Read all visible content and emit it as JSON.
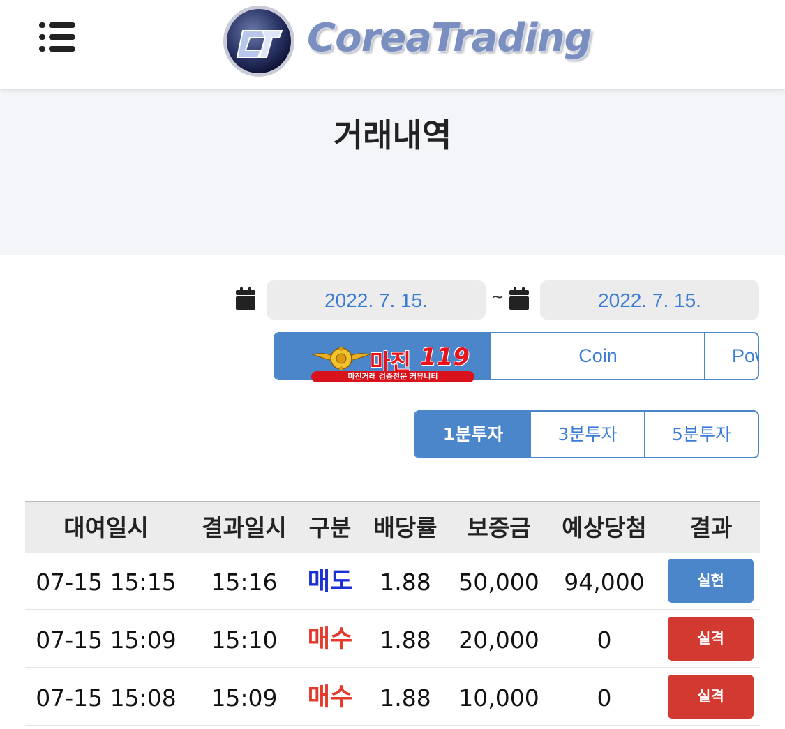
{
  "header": {
    "logo_text": "CoreaTrading",
    "logo_mark_text": "CT"
  },
  "page_title": "거래내역",
  "date_range": {
    "start": "2022. 7. 15.",
    "end": "2022. 7. 15.",
    "separator": "~"
  },
  "category_tabs": [
    {
      "label": "",
      "active": true
    },
    {
      "label": "Coin",
      "active": false
    },
    {
      "label": "Pow",
      "active": false
    }
  ],
  "badge": {
    "title": "마진",
    "number": "119",
    "tagline": "마진거래 검증전문 커뮤니티"
  },
  "interval_tabs": [
    {
      "label": "1분투자",
      "active": true
    },
    {
      "label": "3분투자",
      "active": false
    },
    {
      "label": "5분투자",
      "active": false
    }
  ],
  "table": {
    "headers": [
      "대여일시",
      "결과일시",
      "구분",
      "배당률",
      "보증금",
      "예상당첨",
      "결과"
    ],
    "rows": [
      {
        "rent_time": "07-15 15:15",
        "result_time": "15:16",
        "type": "매도",
        "odds": "1.88",
        "deposit": "50,000",
        "expected": "94,000",
        "result": "실현"
      },
      {
        "rent_time": "07-15 15:09",
        "result_time": "15:10",
        "type": "매수",
        "odds": "1.88",
        "deposit": "20,000",
        "expected": "0",
        "result": "실격"
      },
      {
        "rent_time": "07-15 15:08",
        "result_time": "15:09",
        "type": "매수",
        "odds": "1.88",
        "deposit": "10,000",
        "expected": "0",
        "result": "실격"
      }
    ]
  },
  "colors": {
    "accent_blue": "#4a86c9",
    "sell_blue": "#1a2fd6",
    "buy_red": "#e33a2b",
    "win_button": "#4a86c9",
    "lose_button": "#d23a31"
  }
}
